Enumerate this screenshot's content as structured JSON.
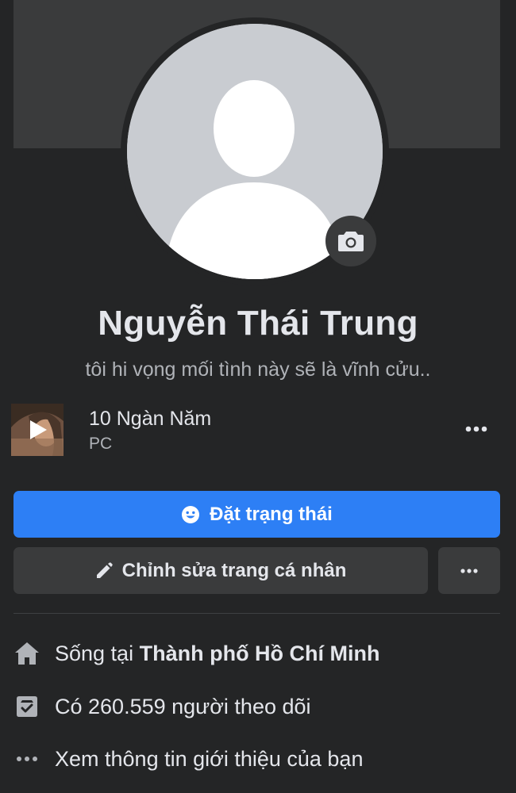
{
  "profile": {
    "name": "Nguyễn Thái Trung",
    "bio": "tôi hi vọng mối tình này sẽ là vĩnh cửu.."
  },
  "music": {
    "title": "10 Ngàn Năm",
    "artist": "PC"
  },
  "actions": {
    "primary_label": "Đặt trạng thái",
    "secondary_label": "Chỉnh sửa trang cá nhân"
  },
  "intro": {
    "lives_in_prefix": "Sống tại",
    "lives_in_city": "Thành phố Hồ Chí Minh",
    "followers_text": "Có 260.559 người theo dõi",
    "see_about": "Xem thông tin giới thiệu của bạn"
  },
  "icons": {
    "camera": "camera-icon",
    "play": "play-icon",
    "more": "more-horizontal-icon",
    "smile": "smile-icon",
    "pencil": "pencil-icon",
    "home": "home-icon",
    "followers": "followers-icon"
  },
  "colors": {
    "background": "#242526",
    "surface": "#3a3b3c",
    "accent": "#2d7ff5",
    "text_primary": "#e4e6eb",
    "text_secondary": "#b0b3b8"
  }
}
